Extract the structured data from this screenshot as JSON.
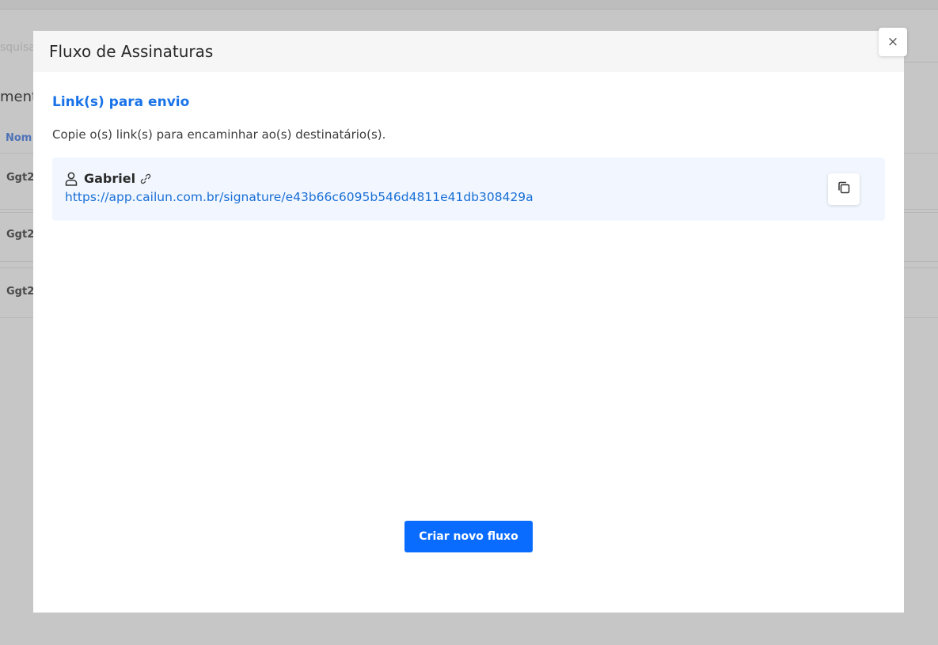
{
  "background": {
    "search_fragment": "squisa",
    "heading_fragment": "mento",
    "column_header_fragment": "Nom",
    "rows": [
      "Ggt2",
      "Ggt2",
      "Ggt2"
    ]
  },
  "modal": {
    "title": "Fluxo de Assinaturas",
    "close_label": "×",
    "section_title": "Link(s) para envio",
    "description": "Copie o(s) link(s) para encaminhar ao(s) destinatário(s).",
    "signers": [
      {
        "name": "Gabriel",
        "url": "https://app.cailun.com.br/signature/e43b66c6095b546d4811e41db308429a"
      }
    ],
    "primary_button": "Criar novo fluxo"
  },
  "colors": {
    "accent": "#1a73e8",
    "button": "#0a6cff",
    "card_bg": "#f2f7ff",
    "overlay": "#c6c6c6"
  },
  "icons": {
    "signer": "user-icon",
    "link": "link-icon",
    "copy": "copy-icon",
    "close": "close-icon"
  }
}
